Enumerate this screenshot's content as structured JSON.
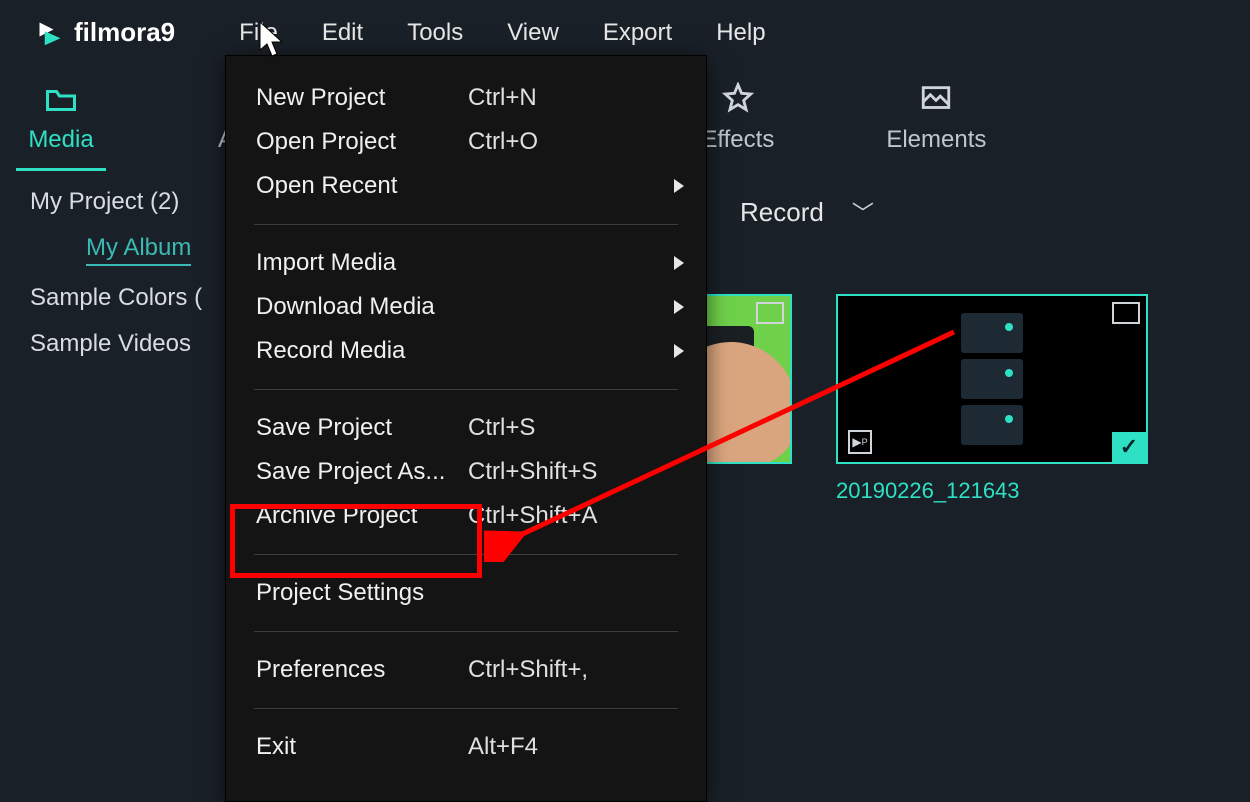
{
  "app": {
    "name": "filmora9"
  },
  "menubar": {
    "file": "File",
    "edit": "Edit",
    "tools": "Tools",
    "view": "View",
    "export": "Export",
    "help": "Help"
  },
  "nav_tabs": {
    "media": "Media",
    "audio": "Audio",
    "effects": "Effects",
    "elements": "Elements"
  },
  "sidebar": {
    "my_project": "My Project (2)",
    "my_album": "My Album",
    "sample_colors": "Sample Colors (",
    "sample_videos": "Sample Videos "
  },
  "record_button": {
    "label": "Record"
  },
  "file_menu": {
    "items": [
      {
        "label": "New Project",
        "shortcut": "Ctrl+N",
        "submenu": false
      },
      {
        "label": "Open Project",
        "shortcut": "Ctrl+O",
        "submenu": false
      },
      {
        "label": "Open Recent",
        "shortcut": "",
        "submenu": true
      },
      {
        "label": "Import Media",
        "shortcut": "",
        "submenu": true
      },
      {
        "label": "Download Media",
        "shortcut": "",
        "submenu": true
      },
      {
        "label": "Record Media",
        "shortcut": "",
        "submenu": true
      },
      {
        "label": "Save Project",
        "shortcut": "Ctrl+S",
        "submenu": false
      },
      {
        "label": "Save Project As...",
        "shortcut": "Ctrl+Shift+S",
        "submenu": false
      },
      {
        "label": "Archive Project",
        "shortcut": "Ctrl+Shift+A",
        "submenu": false
      },
      {
        "label": "Project Settings",
        "shortcut": "",
        "submenu": false
      },
      {
        "label": "Preferences",
        "shortcut": "Ctrl+Shift+,",
        "submenu": false
      },
      {
        "label": "Exit",
        "shortcut": "Alt+F4",
        "submenu": false
      }
    ]
  },
  "thumbnails": {
    "clip1_caption": "20190226_121643"
  },
  "icons": {
    "folder": "folder-icon",
    "music": "music-icon",
    "star": "star-icon",
    "image": "image-icon"
  },
  "colors": {
    "accent": "#2ee0c4",
    "annotation": "#ff0000",
    "bg": "#1a2028",
    "menu_bg": "#141414"
  }
}
